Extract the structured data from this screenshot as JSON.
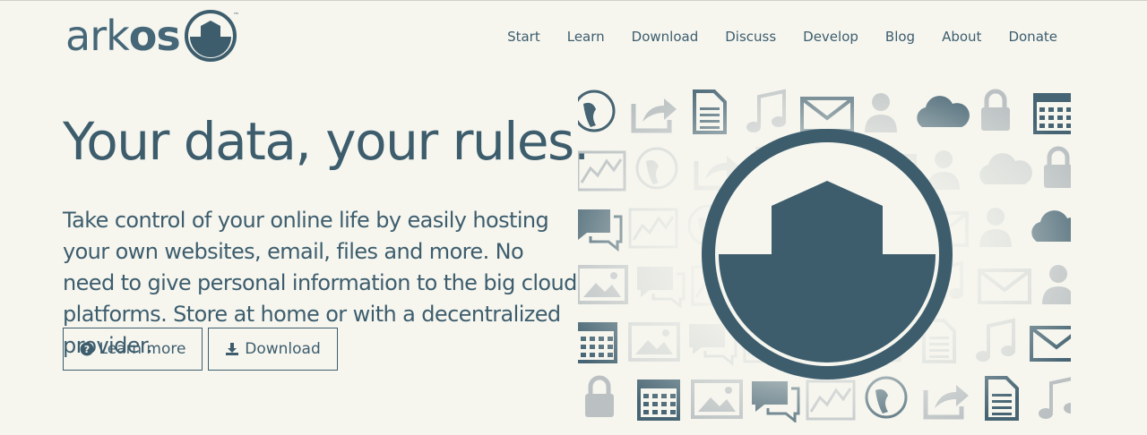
{
  "brand": {
    "name_prefix": "ark",
    "name_bold": "os",
    "trademark": "™"
  },
  "nav": {
    "items": [
      {
        "label": "Start"
      },
      {
        "label": "Learn"
      },
      {
        "label": "Download"
      },
      {
        "label": "Discuss"
      },
      {
        "label": "Develop"
      },
      {
        "label": "Blog"
      },
      {
        "label": "About"
      },
      {
        "label": "Donate"
      }
    ]
  },
  "hero": {
    "headline": "Your data, your rules.",
    "intro": "Take control of your online life by easily hosting your own websites, email, files and more. No need to give personal information to the big cloud platforms. Store at home or with a decentralized provider.",
    "learn_more_label": "Learn more",
    "download_label": "Download",
    "learn_more_icon": "question-circle-icon",
    "download_icon": "download-icon"
  },
  "colors": {
    "primary": "#3d5d6d",
    "background": "#f6f6ef",
    "tile": "#b8bfc1"
  }
}
